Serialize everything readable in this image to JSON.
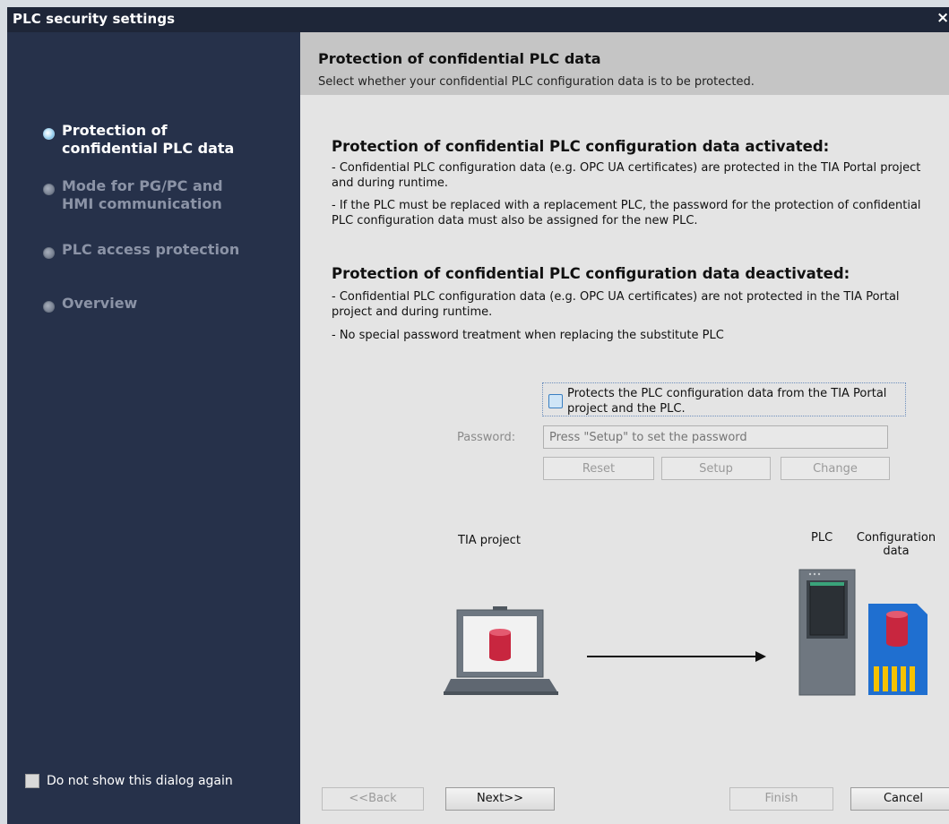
{
  "window": {
    "title": "PLC security settings",
    "close_glyph": "×"
  },
  "sidebar": {
    "items": [
      {
        "label": "Protection of confidential PLC data",
        "state": "active"
      },
      {
        "label": "Mode for PG/PC and HMI communication",
        "state": "inactive"
      },
      {
        "label": "PLC access protection",
        "state": "inactive"
      },
      {
        "label": "Overview",
        "state": "inactive"
      }
    ],
    "dont_show_label": "Do not show this dialog again"
  },
  "header": {
    "title": "Protection of confidential PLC data",
    "subtitle": "Select whether your confidential PLC configuration data is to be protected."
  },
  "activated": {
    "title": "Protection of confidential PLC configuration data activated:",
    "line1": "- Confidential PLC configuration data (e.g. OPC UA certificates) are protected in the TIA Portal project and during runtime.",
    "line2": "- If the PLC must be replaced with a replacement PLC, the password for the protection of confidential PLC configuration data must also be assigned for the new PLC."
  },
  "deactivated": {
    "title": "Protection of confidential PLC configuration data deactivated:",
    "line1": "- Confidential PLC configuration data (e.g. OPC UA certificates) are not protected in the TIA Portal project and during runtime.",
    "line2": "- No special password treatment when replacing the substitute PLC"
  },
  "protect": {
    "label": "Protects the PLC configuration data from the TIA Portal project and the PLC.",
    "checked": false
  },
  "password": {
    "label": "Password:",
    "placeholder": "Press \"Setup\" to set the password"
  },
  "pw_buttons": {
    "reset": "Reset",
    "setup": "Setup",
    "change": "Change"
  },
  "diagram": {
    "tia_label": "TIA project",
    "plc_label": "PLC",
    "config_label": "Configuration data"
  },
  "footer": {
    "back": "<<Back",
    "next": "Next>>",
    "finish": "Finish",
    "cancel": "Cancel"
  },
  "colors": {
    "sidebar": "#26314a",
    "titlebar": "#1e2638",
    "header": "#c5c5c5",
    "content": "#e4e4e4",
    "db_red": "#c8263f",
    "card_blue": "#1f6fd0",
    "card_gold": "#f5c200",
    "plc_gray": "#6f7780"
  }
}
